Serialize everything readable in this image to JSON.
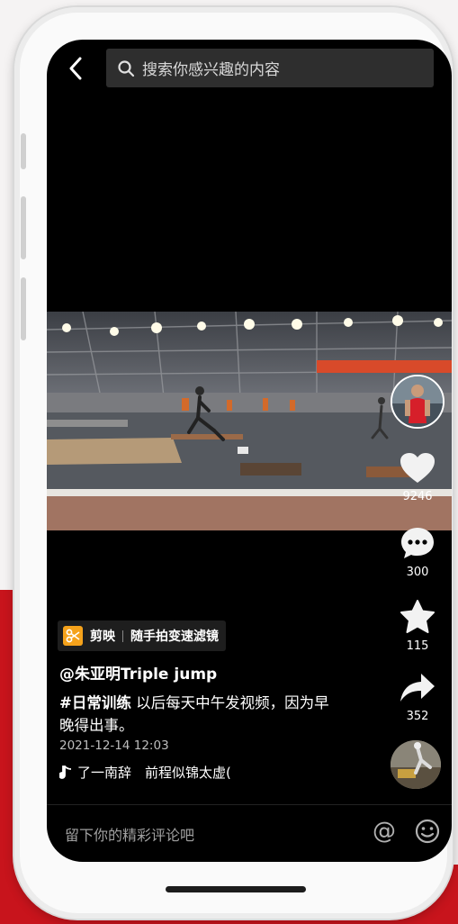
{
  "search": {
    "placeholder": "搜索你感兴趣的内容"
  },
  "rail": {
    "likes": "9246",
    "comments": "300",
    "favorites": "115",
    "shares": "352"
  },
  "capcut": {
    "brand": "剪映",
    "action": "随手拍变速滤镜"
  },
  "post": {
    "author": "@朱亚明Triple jump",
    "hashtag": "#日常训练",
    "text": " 以后每天中午发视频，因为早晚得出事。",
    "date": "2021-12-14 12:03",
    "music": "了一南辞　前程似锦太虚("
  },
  "comment_bar": {
    "placeholder": "留下你的精彩评论吧"
  },
  "colors": {
    "accent_orange": "#f5a21b",
    "backdrop_red": "#c8141c"
  },
  "icons": [
    "back-arrow-icon",
    "search-icon",
    "heart-icon",
    "comment-icon",
    "star-icon",
    "share-icon",
    "scissors-icon",
    "music-note-icon",
    "at-icon",
    "emoji-icon"
  ]
}
